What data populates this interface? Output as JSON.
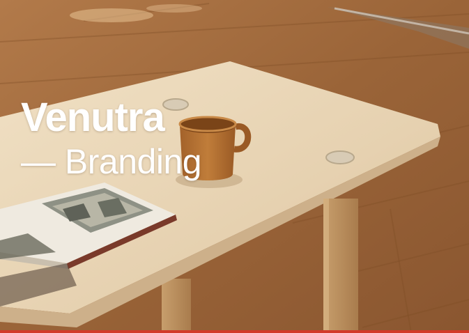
{
  "card": {
    "title": "Venutra",
    "subtitle": "— Branding"
  },
  "colors": {
    "accent": "#d23a2a",
    "floor": "#a06a3e",
    "table_top": "#e9d6b8",
    "mug": "#b5722f",
    "text": "#ffffff"
  }
}
